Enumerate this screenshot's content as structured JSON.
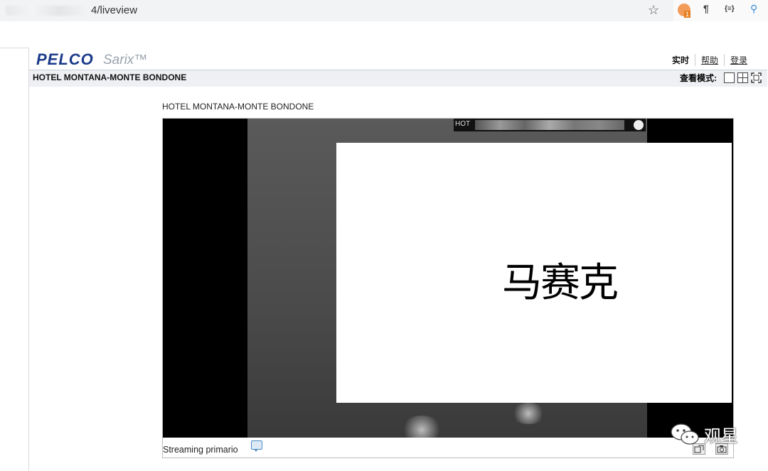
{
  "browser": {
    "url": "4/liveview",
    "icons": [
      "star-icon",
      "extension-badge-icon",
      "pilcrow-icon",
      "json-icon",
      "pin-icon"
    ],
    "badge_count": "1"
  },
  "header": {
    "logo": "PELCO",
    "logo_sub": "Sarix™",
    "nav": [
      "实时",
      "帮助",
      "登录"
    ]
  },
  "titlebar": {
    "title": "HOTEL MONTANA-MONTE BONDONE",
    "viewmode_label": "查看模式:"
  },
  "camera": {
    "label": "HOTEL MONTANA-MONTE BONDONE",
    "osd_prefix": "HOT",
    "overlay_text": "马赛克",
    "stream_label": "Streaming primario"
  },
  "watermark": {
    "text": "观星"
  },
  "colors": {
    "brand": "#1a3a8a",
    "titlebar": "#eef0f3",
    "video_bg": "#000000"
  }
}
